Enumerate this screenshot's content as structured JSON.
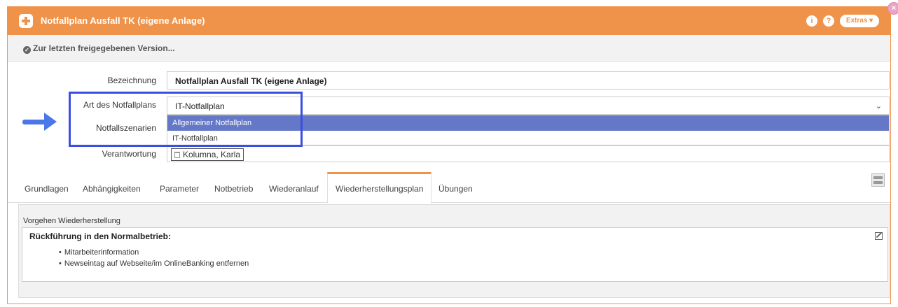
{
  "window": {
    "title": "Notfallplan Ausfall TK (eigene Anlage)",
    "info_label": "i",
    "help_label": "?",
    "extras_label": "Extras ▾",
    "close_label": "×"
  },
  "version": {
    "link_label": "Zur letzten freigegebenen Version..."
  },
  "form": {
    "bezeichnung_label": "Bezeichnung",
    "bezeichnung_value": "Notfallplan Ausfall TK (eigene Anlage)",
    "art_label": "Art des Notfallplans",
    "art_value": "IT-Notfallplan",
    "art_options": [
      "Allgemeiner Notfallplan",
      "IT-Notfallplan"
    ],
    "art_selected_index": 0,
    "szenarien_label": "Notfallszenarien",
    "verantwortung_label": "Verantwortung",
    "verantwortung_tag": "Kolumna, Karla"
  },
  "tabs": [
    {
      "label": "Grundlagen",
      "active": false
    },
    {
      "label": "Abhängigkeiten",
      "active": false
    },
    {
      "label": "Parameter",
      "active": false
    },
    {
      "label": "Notbetrieb",
      "active": false
    },
    {
      "label": "Wiederanlauf",
      "active": false
    },
    {
      "label": "Wiederherstellungsplan",
      "active": true
    },
    {
      "label": "Übungen",
      "active": false
    }
  ],
  "panel": {
    "label": "Vorgehen Wiederherstellung",
    "heading": "Rückführung in den Normalbetrieb:",
    "items": [
      "Mitarbeiterinformation",
      "Newseintag auf Webseite/im OnlineBanking entfernen"
    ]
  },
  "colors": {
    "accent": "#f0934a",
    "selection": "#6578c8",
    "highlight_border": "#3a4fe0",
    "arrow": "#4a78e8"
  }
}
